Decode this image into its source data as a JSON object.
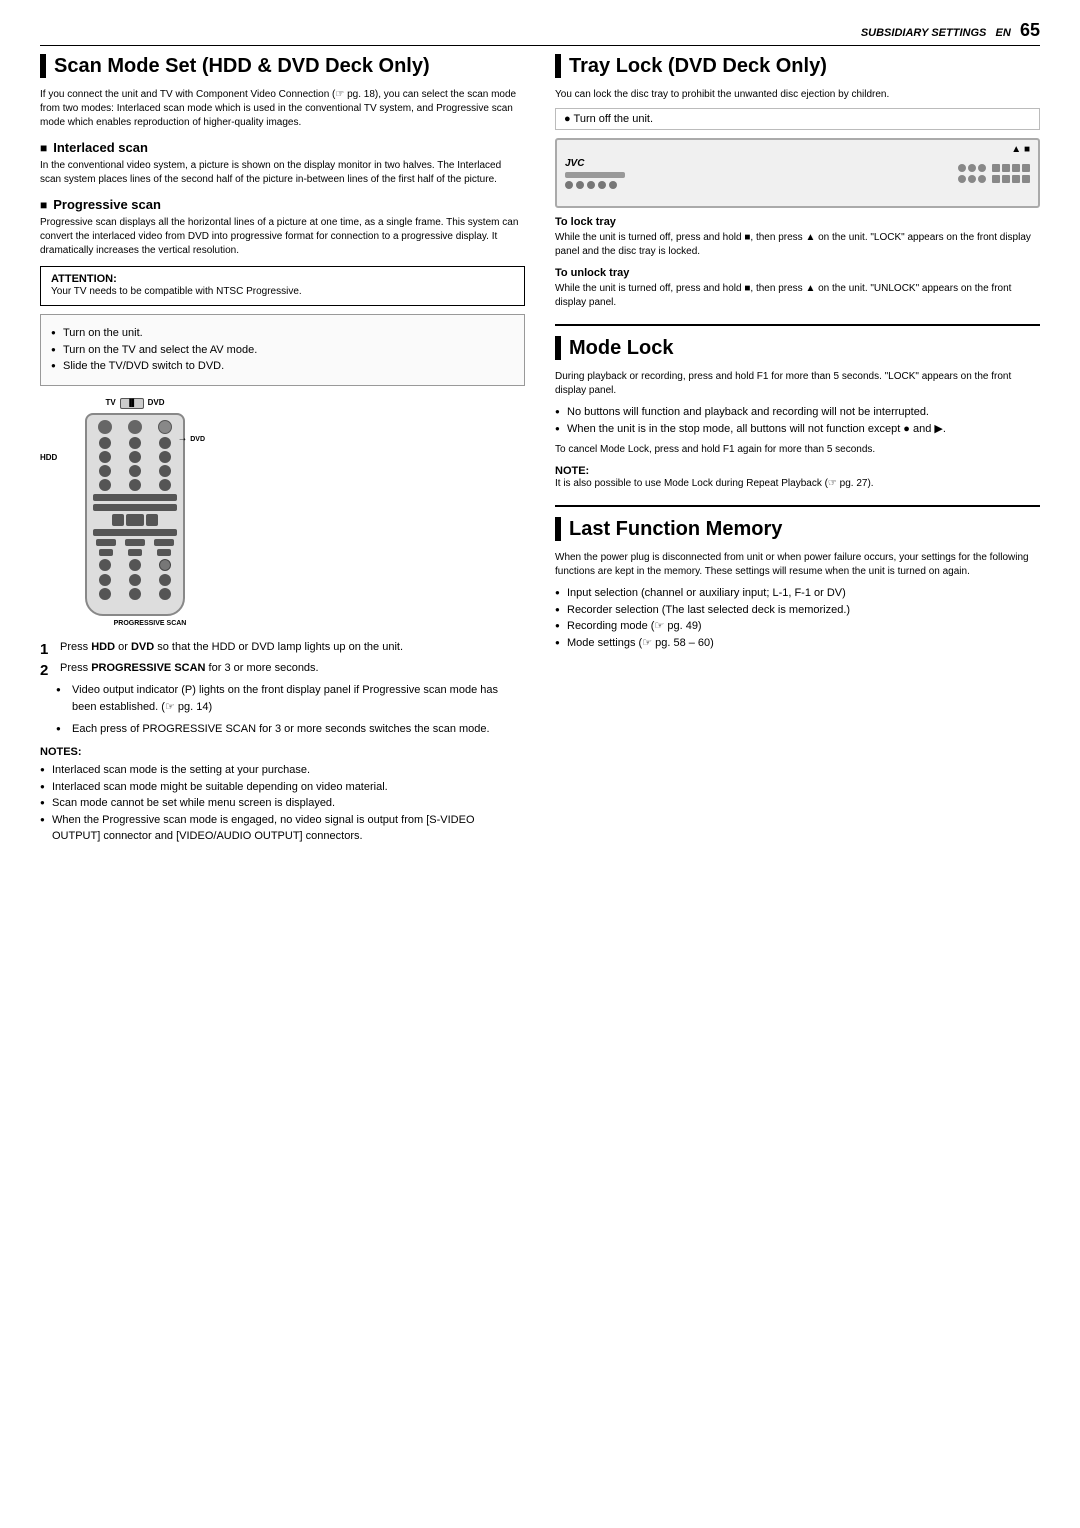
{
  "header": {
    "section": "SUBSIDIARY SETTINGS",
    "lang": "EN",
    "page": "65"
  },
  "left_section": {
    "title": "Scan Mode Set (HDD & DVD Deck Only)",
    "intro": "If you connect the unit and TV with Component Video Connection (☞ pg. 18), you can select the scan mode from two modes: Interlaced scan mode which is used in the conventional TV system, and Progressive scan mode which enables reproduction of higher-quality images.",
    "interlaced_title": "Interlaced scan",
    "interlaced_text": "In the conventional video system, a picture is shown on the display monitor in two halves. The Interlaced scan system places lines of the second half of the picture in-between lines of the first half of the picture.",
    "progressive_title": "Progressive scan",
    "progressive_text": "Progressive scan displays all the horizontal lines of a picture at one time, as a single frame. This system can convert the interlaced video from DVD into progressive format for connection to a progressive display. It dramatically increases the vertical resolution.",
    "attention_title": "ATTENTION:",
    "attention_text": "Your TV needs to be compatible with NTSC Progressive.",
    "steps_before": [
      "Turn on the unit.",
      "Turn on the TV and select the AV mode.",
      "Slide the TV/DVD switch to DVD."
    ],
    "remote_label_hdd": "HDD",
    "remote_label_dvd": "DVD",
    "remote_label_progressive": "PROGRESSIVE SCAN",
    "steps": [
      {
        "num": "1",
        "text": "Press HDD or DVD so that the HDD or DVD lamp lights up on the unit."
      },
      {
        "num": "2",
        "text": "Press PROGRESSIVE SCAN for 3 or more seconds."
      }
    ],
    "sub_bullets": [
      "Video output indicator (P) lights on the front display panel if Progressive scan mode has been established. (☞ pg. 14)",
      "Each press of PROGRESSIVE SCAN for 3 or more seconds switches the scan mode."
    ],
    "notes_title": "NOTES:",
    "notes": [
      "Interlaced scan mode is the setting at your purchase.",
      "Interlaced scan mode might be suitable depending on video material.",
      "Scan mode cannot be set while menu screen is displayed.",
      "When the Progressive scan mode is engaged, no video signal is output from [S-VIDEO OUTPUT] connector and [VIDEO/AUDIO OUTPUT] connectors."
    ]
  },
  "right_section": {
    "tray_lock_title": "Tray Lock (DVD Deck Only)",
    "tray_lock_intro": "You can lock the disc tray to prohibit the unwanted disc ejection by children.",
    "turn_off_unit": "Turn off the unit.",
    "to_lock_tray_title": "To lock tray",
    "to_lock_tray_text": "While the unit is turned off, press and hold ■, then press ▲ on the unit. \"LOCK\" appears on the front display panel and the disc tray is locked.",
    "to_unlock_tray_title": "To unlock tray",
    "to_unlock_tray_text": "While the unit is turned off, press and hold ■, then press ▲ on the unit. \"UNLOCK\" appears on the front display panel.",
    "mode_lock_title": "Mode Lock",
    "mode_lock_intro": "During playback or recording, press and hold F1 for more than 5 seconds. \"LOCK\" appears on the front display panel.",
    "mode_lock_bullets": [
      "No buttons will function and playback and recording will not be interrupted.",
      "When the unit is in the stop mode, all buttons will not function except ● and ▶."
    ],
    "mode_lock_cancel": "To cancel Mode Lock, press and hold F1 again for more than 5 seconds.",
    "mode_lock_note_title": "NOTE:",
    "mode_lock_note": "It is also possible to use Mode Lock during Repeat Playback (☞ pg. 27).",
    "last_function_title": "Last Function Memory",
    "last_function_intro": "When the power plug is disconnected from unit or when power failure occurs, your settings for the following functions are kept in the memory. These settings will resume when the unit is turned on again.",
    "last_function_bullets": [
      "Input selection (channel or auxiliary input; L-1, F-1 or DV)",
      "Recorder selection (The last selected deck is memorized.)",
      "Recording mode (☞ pg. 49)",
      "Mode settings (☞ pg. 58 – 60)"
    ]
  }
}
